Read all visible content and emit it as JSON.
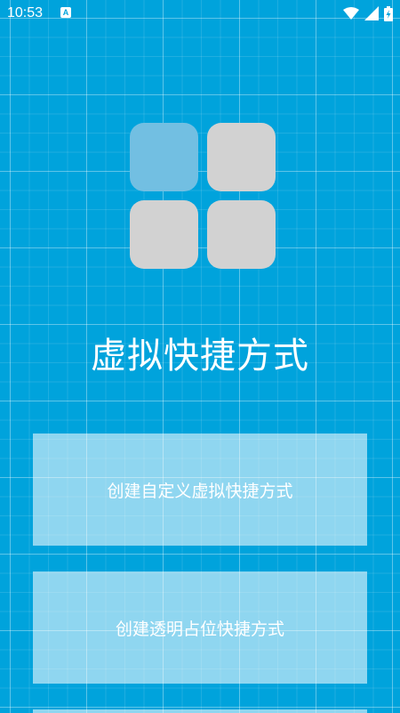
{
  "status_bar": {
    "time": "10:53",
    "notification_icon": "A",
    "icons": [
      "wifi-icon",
      "signal-icon",
      "battery-charging-icon"
    ]
  },
  "app": {
    "title": "虚拟快捷方式",
    "logo_icon": "four-tile-grid-icon"
  },
  "actions": [
    {
      "label": "创建自定义虚拟快捷方式"
    },
    {
      "label": "创建透明占位快捷方式"
    },
    {
      "label": ""
    }
  ],
  "colors": {
    "background": "#00a3dc",
    "tile": "#d2d2d2",
    "tile_highlight": "#72bfe2",
    "text": "#ffffff"
  }
}
